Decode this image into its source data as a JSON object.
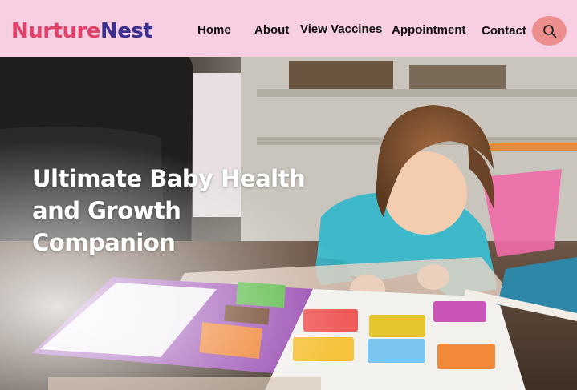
{
  "brand": {
    "part1": "Nurture",
    "part2": "Nest",
    "color1": "#e0426a",
    "color2": "#3b2f8f"
  },
  "nav": {
    "items": [
      {
        "label": "Home"
      },
      {
        "label": "About"
      },
      {
        "label": "View Vaccines"
      },
      {
        "label": "Appointment"
      },
      {
        "label": "Contact"
      }
    ],
    "search_icon": "search-icon",
    "background": "#f8cfe2",
    "search_button_color": "#ec8e8e"
  },
  "hero": {
    "headline_lines": [
      "Ultimate Baby Health",
      "and Growth",
      "Companion"
    ],
    "image": "toddler-reading-picture-book-photo"
  }
}
